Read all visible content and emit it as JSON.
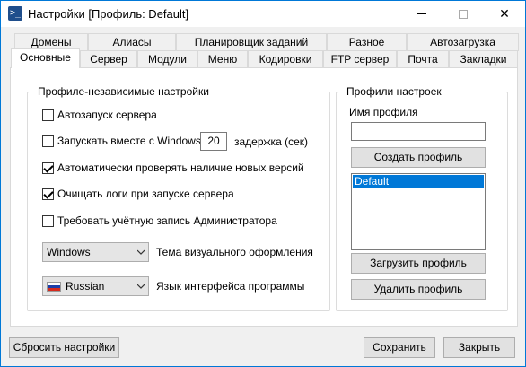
{
  "window": {
    "title": "Настройки [Профиль: Default]",
    "app_icon_glyph": ">_",
    "close_glyph": "✕"
  },
  "tabs_row1": [
    "Домены",
    "Алиасы",
    "Планировщик заданий",
    "Разное",
    "Автозагрузка"
  ],
  "tabs_row2": [
    "Основные",
    "Сервер",
    "Модули",
    "Меню",
    "Кодировки",
    "FTP сервер",
    "Почта",
    "Закладки"
  ],
  "active_tab": "Основные",
  "general_group": {
    "title": "Профиле-независимые настройки",
    "autostart_server": {
      "label": "Автозапуск сервера",
      "checked": false
    },
    "start_with_windows": {
      "label": "Запускать вместе с Windows",
      "checked": false
    },
    "delay_value": "20",
    "delay_label": "задержка (сек)",
    "check_updates": {
      "label": "Автоматически проверять наличие новых версий",
      "checked": true
    },
    "clear_logs": {
      "label": "Очищать логи при запуске сервера",
      "checked": true
    },
    "require_admin": {
      "label": "Требовать учётную запись Администратора",
      "checked": false
    },
    "theme_select": {
      "value": "Windows",
      "label": "Тема визуального оформления"
    },
    "language_select": {
      "value": "Russian",
      "label": "Язык интерфейса программы"
    }
  },
  "profiles_group": {
    "title": "Профили настроек",
    "profile_name_label": "Имя профиля",
    "profile_name_value": "",
    "create_button": "Создать профиль",
    "profiles": [
      "Default"
    ],
    "load_button": "Загрузить профиль",
    "delete_button": "Удалить профиль"
  },
  "footer": {
    "reset_button": "Сбросить настройки",
    "save_button": "Сохранить",
    "close_button": "Закрыть"
  },
  "colors": {
    "accent": "#0078d7",
    "panel_bg": "#ffffff",
    "window_bg": "#f0f0f0",
    "button_bg": "#e1e1e1"
  }
}
